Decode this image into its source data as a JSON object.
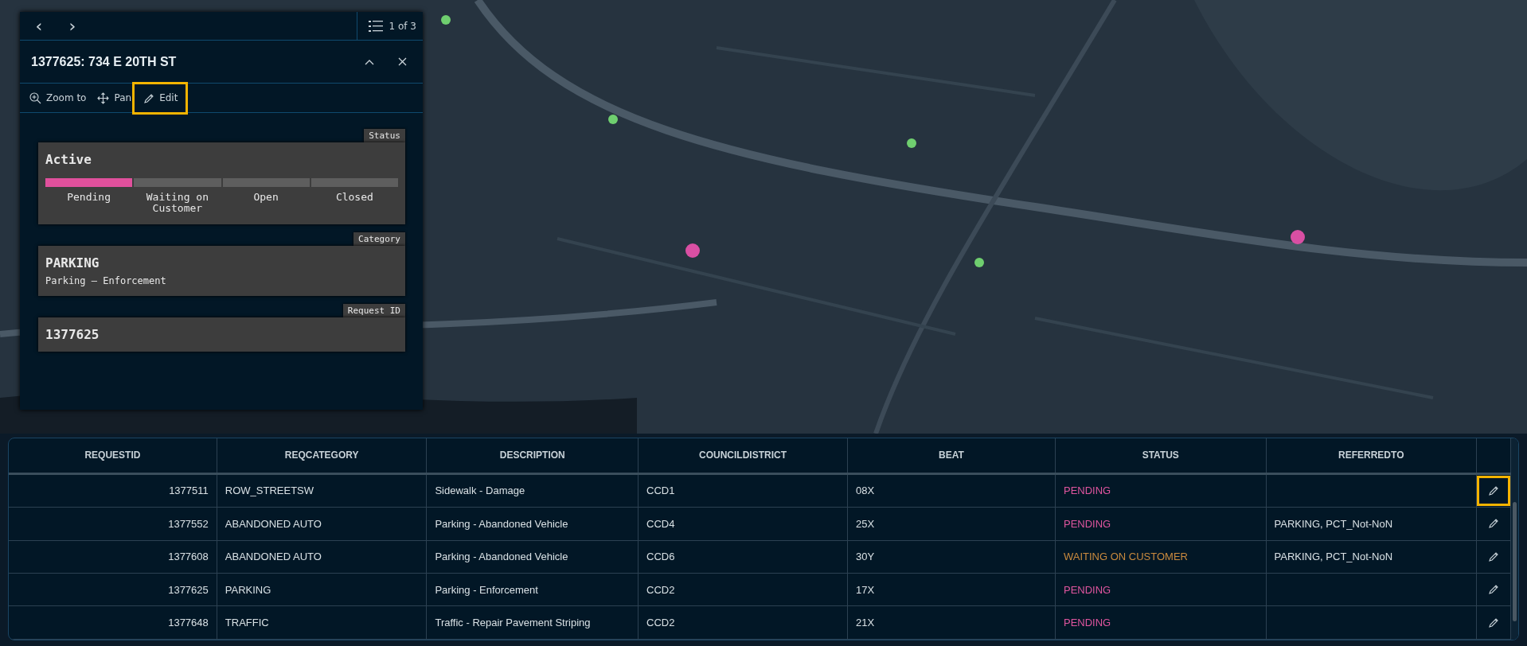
{
  "popup": {
    "nav": {
      "previous": "‹",
      "next": "›",
      "count": "1 of 3"
    },
    "title": "1377625: 734 E 20TH ST",
    "actions": [
      {
        "kind": "zoom",
        "label": "Zoom to",
        "highlighted": false
      },
      {
        "kind": "pan",
        "label": "Pan",
        "highlighted": false
      },
      {
        "kind": "edit",
        "label": "Edit",
        "highlighted": true
      }
    ],
    "cards": [
      {
        "kind": "status",
        "tag": "Status",
        "heading": "Active",
        "steps": [
          {
            "label": "Pending",
            "selected": true
          },
          {
            "label": "Waiting on Customer",
            "selected": false
          },
          {
            "label": "Open",
            "selected": false
          },
          {
            "label": "Closed",
            "selected": false
          }
        ]
      },
      {
        "kind": "text",
        "tag": "Category",
        "heading": "PARKING",
        "detail": "Parking – Enforcement"
      },
      {
        "kind": "text",
        "tag": "Request ID",
        "heading": "1377625"
      }
    ]
  },
  "table": {
    "columns": [
      "REQUESTID",
      "REQCATEGORY",
      "DESCRIPTION",
      "COUNCILDISTRICT",
      "BEAT",
      "STATUS",
      "REFERREDTO"
    ],
    "rows": [
      {
        "cells": [
          "1377511",
          "ROW_STREETSW",
          "Sidewalk - Damage",
          "CCD1",
          "08X",
          "PENDING",
          ""
        ],
        "color": "#e0559f",
        "highlighted": true
      },
      {
        "cells": [
          "1377552",
          "ABANDONED AUTO",
          "Parking - Abandoned Vehicle",
          "CCD4",
          "25X",
          "PENDING",
          "PARKING, PCT_Not-NoN"
        ],
        "color": "#e0559f",
        "highlighted": false
      },
      {
        "cells": [
          "1377608",
          "ABANDONED AUTO",
          "Parking - Abandoned Vehicle",
          "CCD6",
          "30Y",
          "WAITING ON CUSTOMER",
          "PARKING, PCT_Not-NoN"
        ],
        "color": "#c98a3e",
        "highlighted": false
      },
      {
        "cells": [
          "1377625",
          "PARKING",
          "Parking - Enforcement",
          "CCD2",
          "17X",
          "PENDING",
          ""
        ],
        "color": "#e0559f",
        "highlighted": false
      },
      {
        "cells": [
          "1377648",
          "TRAFFIC",
          "Traffic - Repair Pavement Striping",
          "CCD2",
          "21X",
          "PENDING",
          ""
        ],
        "color": "#e0559f",
        "highlighted": false
      }
    ]
  }
}
